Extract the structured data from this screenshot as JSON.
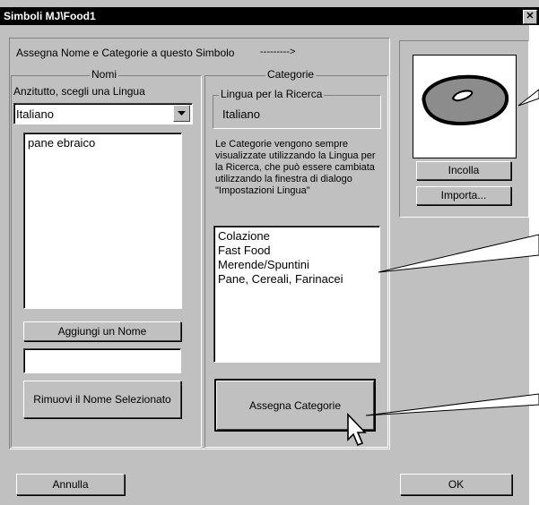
{
  "window": {
    "title": "Simboli MJ\\Food1",
    "close_glyph": "✕"
  },
  "instruction": "Assegna Nome e Categorie a questo Simbolo",
  "arrow_text": "--------->",
  "names": {
    "group_label": "Nomi",
    "prompt": "Anzitutto, scegli una Lingua",
    "language_selected": "Italiano",
    "items": [
      "pane ebraico"
    ],
    "add_button": "Aggiungi un Nome",
    "new_name_value": "",
    "remove_button": "Rimuovi il Nome Selezionato"
  },
  "categories": {
    "group_label": "Categorie",
    "search_language_label": "Lingua per la Ricerca",
    "search_language_value": "Italiano",
    "note": "Le Categorie vengono sempre visualizzate utilizzando la Lingua per la Ricerca, che può essere cambiata utilizzando la finestra di dialogo \"Impostazioni Lingua\"",
    "items": [
      "Colazione",
      "Fast Food",
      "Merende/Spuntini",
      "Pane, Cereali, Farinacei"
    ],
    "assign_button": "Assegna Categorie"
  },
  "symbol": {
    "paste_button": "Incolla",
    "import_button": "Importa..."
  },
  "footer": {
    "cancel_button": "Annulla",
    "ok_button": "OK"
  },
  "icons": {
    "dropdown": "chevron-down-icon",
    "cursor": "mouse-pointer-icon",
    "symbol": "bagel-icon"
  }
}
